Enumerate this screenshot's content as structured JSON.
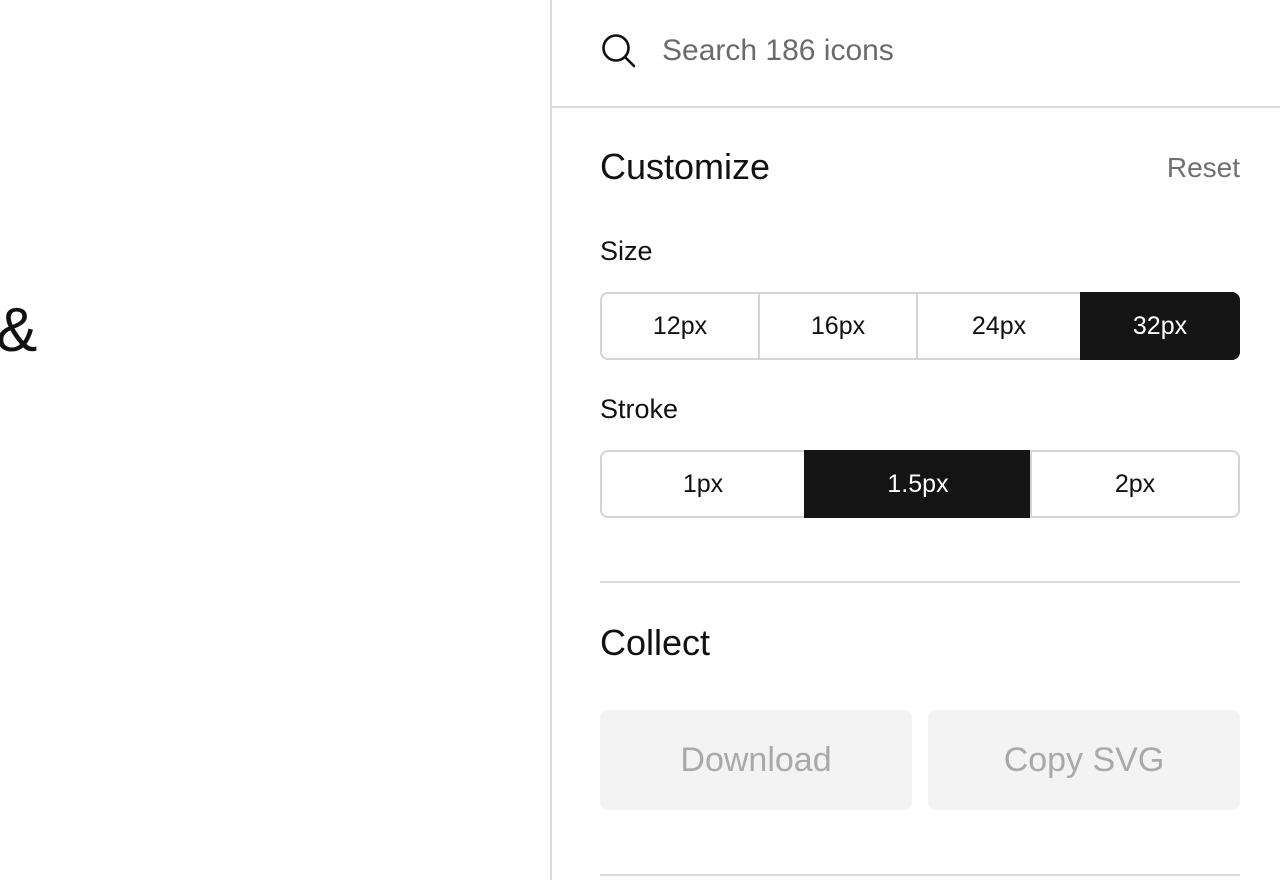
{
  "preview": {
    "glyph": "&"
  },
  "search": {
    "placeholder": "Search 186 icons",
    "value": ""
  },
  "customize": {
    "title": "Customize",
    "reset_label": "Reset",
    "size": {
      "label": "Size",
      "options": [
        "12px",
        "16px",
        "24px",
        "32px"
      ],
      "selected": "32px"
    },
    "stroke": {
      "label": "Stroke",
      "options": [
        "1px",
        "1.5px",
        "2px"
      ],
      "selected": "1.5px"
    }
  },
  "collect": {
    "title": "Collect",
    "download_label": "Download",
    "copy_svg_label": "Copy SVG"
  },
  "colors": {
    "active_bg": "#141414",
    "active_text": "#ffffff",
    "disabled_bg": "#f3f3f3",
    "disabled_text": "#a9a9a9",
    "divider": "#dcdcdc"
  },
  "icons": [
    "search-icon"
  ]
}
